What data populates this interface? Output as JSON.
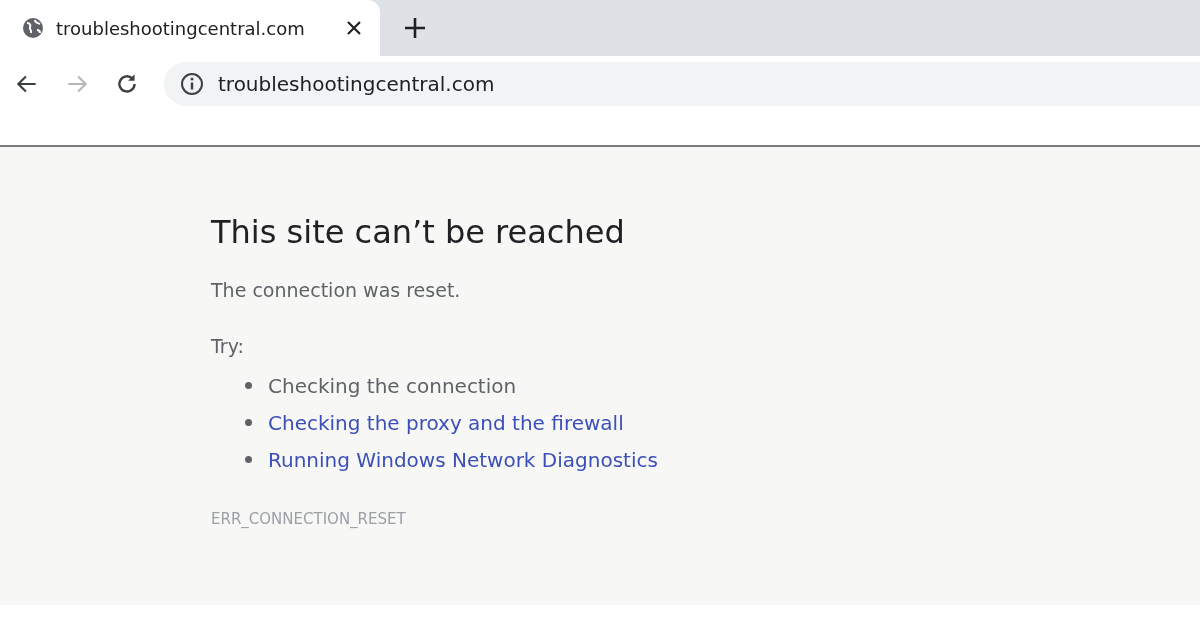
{
  "tab": {
    "title": "troubleshootingcentral.com",
    "selected": true
  },
  "nav_buttons": [
    {
      "kind": "back",
      "disabled": false
    },
    {
      "kind": "forward",
      "disabled": true
    },
    {
      "kind": "reload",
      "disabled": false
    }
  ],
  "address_bar": {
    "value": "troubleshootingcentral.com"
  },
  "error": {
    "heading": "This site can’t be reached",
    "message": "The connection was reset.",
    "try_label": "Try:",
    "suggestions": [
      {
        "kind": "text",
        "text": "Checking the connection"
      },
      {
        "kind": "link",
        "text": "Checking the proxy and the firewall"
      },
      {
        "kind": "link",
        "text": "Running Windows Network Diagnostics"
      }
    ],
    "code": "ERR_CONNECTION_RESET"
  }
}
